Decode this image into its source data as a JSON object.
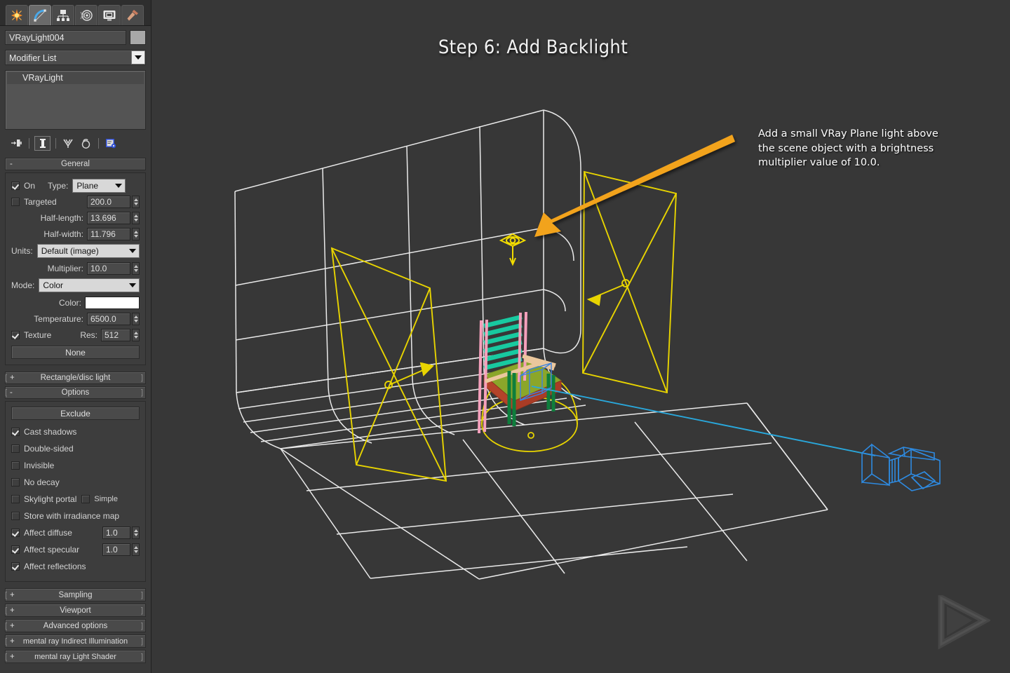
{
  "slide": {
    "title": "Step 6: Add Backlight",
    "annotation_lines": [
      "Add a small VRay Plane light above",
      "the scene object with a brightness",
      "multiplier value of 10.0."
    ],
    "arrow_color": "#F2A31E",
    "viewport_bg": "#373737"
  },
  "panel": {
    "tabs": [
      {
        "name": "create-tab",
        "icon": "star-icon",
        "active": false
      },
      {
        "name": "modify-tab",
        "icon": "arc-icon",
        "active": true
      },
      {
        "name": "hierarchy-tab",
        "icon": "hierarchy-icon",
        "active": false
      },
      {
        "name": "motion-tab",
        "icon": "motion-wheel-icon",
        "active": false
      },
      {
        "name": "display-tab",
        "icon": "display-monitor-icon",
        "active": false
      },
      {
        "name": "utilities-tab",
        "icon": "hammer-icon",
        "active": false
      }
    ],
    "object_name": "VRayLight004",
    "modifier_list_label": "Modifier List",
    "stack": [
      "VRayLight"
    ],
    "stack_tools": [
      {
        "name": "pin-stack-icon"
      },
      {
        "name": "show-end-result-icon",
        "active": true
      },
      {
        "name": "make-unique-icon"
      },
      {
        "name": "remove-modifier-icon"
      },
      {
        "name": "configure-modifier-sets-icon"
      }
    ],
    "general": {
      "rollout_label": "General",
      "rollout_sign": "-",
      "on_label": "On",
      "on_checked": true,
      "type_label": "Type:",
      "type_value": "Plane",
      "targeted_label": "Targeted",
      "targeted_checked": false,
      "targeted_value": "200.0",
      "half_length_label": "Half-length:",
      "half_length_value": "13.696",
      "half_width_label": "Half-width:",
      "half_width_value": "11.796",
      "units_label": "Units:",
      "units_value": "Default (image)",
      "multiplier_label": "Multiplier:",
      "multiplier_value": "10.0",
      "mode_label": "Mode:",
      "mode_value": "Color",
      "color_label": "Color:",
      "color_value": "#FFFFFF",
      "temperature_label": "Temperature:",
      "temperature_value": "6500.0",
      "texture_label": "Texture",
      "texture_checked": true,
      "res_label": "Res:",
      "res_value": "512",
      "texture_map_button": "None"
    },
    "rect_disc_rollout": {
      "label": "Rectangle/disc light",
      "sign": "+"
    },
    "options": {
      "rollout_label": "Options",
      "rollout_sign": "-",
      "exclude_button": "Exclude",
      "checks": [
        {
          "label": "Cast shadows",
          "checked": true
        },
        {
          "label": "Double-sided",
          "checked": false
        },
        {
          "label": "Invisible",
          "checked": false
        },
        {
          "label": "No decay",
          "checked": false
        },
        {
          "label": "Skylight portal",
          "checked": false
        },
        {
          "label": "Store with irradiance map",
          "checked": false
        }
      ],
      "simple_label": "Simple",
      "simple_checked": false,
      "affect_diffuse_label": "Affect diffuse",
      "affect_diffuse_checked": true,
      "affect_diffuse_value": "1.0",
      "affect_specular_label": "Affect specular",
      "affect_specular_checked": true,
      "affect_specular_value": "1.0",
      "affect_reflections_label": "Affect reflections",
      "affect_reflections_checked": true
    },
    "bottom_rollouts": [
      {
        "label": "Sampling",
        "sign": "+"
      },
      {
        "label": "Viewport",
        "sign": "+"
      },
      {
        "label": "Advanced options",
        "sign": "+"
      },
      {
        "label": "mental ray Indirect Illumination",
        "sign": "+"
      },
      {
        "label": "mental ray Light Shader",
        "sign": "+"
      }
    ]
  },
  "scene": {
    "objects": [
      {
        "name": "cyclorama-backdrop",
        "color": "#E8E8E8"
      },
      {
        "name": "chair-model",
        "colors": [
          "#18C9A0",
          "#F0A0B8",
          "#E8C49A",
          "#8FA82A",
          "#0E7E3C",
          "#B4432A"
        ]
      },
      {
        "name": "vray-plane-light-left",
        "color": "#E8D400"
      },
      {
        "name": "vray-plane-light-right",
        "color": "#E8D400"
      },
      {
        "name": "vray-plane-light-backlight",
        "color": "#F0DC00"
      },
      {
        "name": "omni-dome-gizmo",
        "color": "#E8D400"
      },
      {
        "name": "vray-physical-camera",
        "color": "#2E8AE0"
      },
      {
        "name": "camera-target-line",
        "color": "#29A8DC"
      }
    ]
  },
  "watermark": {
    "name": "triangle-play-logo"
  }
}
